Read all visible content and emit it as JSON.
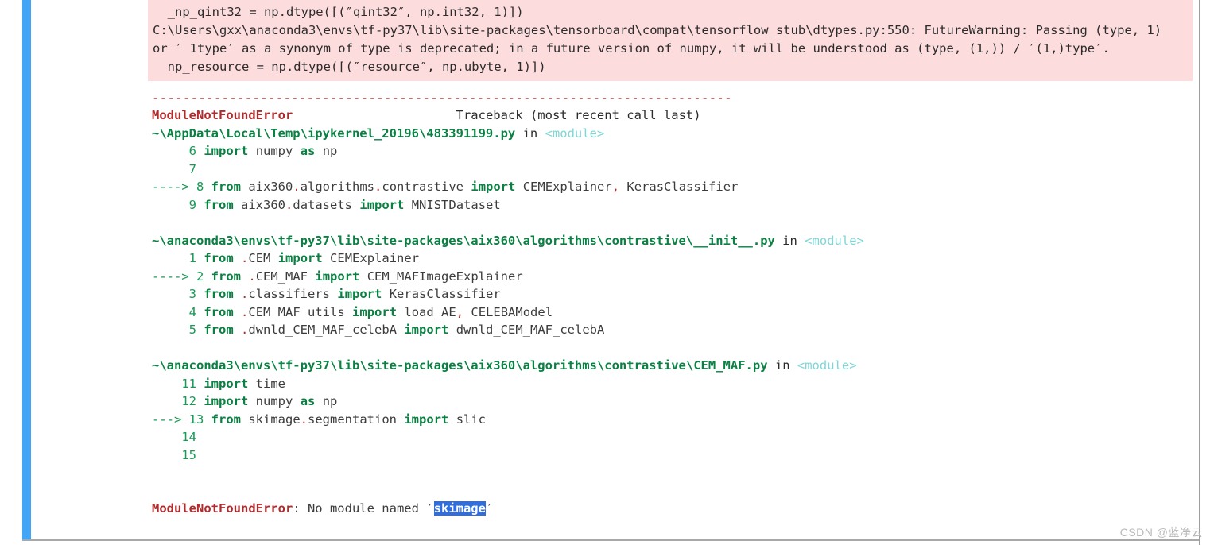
{
  "colors": {
    "cell_selection_bar": "#42a5f5",
    "stderr_background": "#fcdcdc",
    "error_name": "#b02b2b",
    "file_path": "#0a8043",
    "keyword": "#0a8043",
    "line_number": "#159b53",
    "module_tag": "#7fd6d6",
    "separator": "#b03a3a",
    "selection_background": "#2f6ede",
    "selection_text": "#ffffff",
    "watermark": "#b9b9b9"
  },
  "stderr": {
    "lines": [
      "  _np_qint32 = np.dtype([(″qint32″, np.int32, 1)])",
      "C:\\Users\\gxx\\anaconda3\\envs\\tf-py37\\lib\\site-packages\\tensorboard\\compat\\tensorflow_stub\\dtypes.py:550: FutureWarning: Passing (type, 1)",
      "or ′ 1type′ as a synonym of type is deprecated; in a future version of numpy, it will be understood as (type, (1,)) / ′(1,)type′.",
      "  np_resource = np.dtype([(″resource″, np.ubyte, 1)])"
    ]
  },
  "traceback": {
    "separator": "---------------------------------------------------------------------------",
    "header": {
      "exception": "ModuleNotFoundError",
      "gap": "                      ",
      "hint": "Traceback (most recent call last)"
    },
    "frames": [
      {
        "path": "~\\AppData\\Local\\Temp\\ipykernel_20196\\483391199.py",
        "in": " in ",
        "scope": "<module>",
        "lines": [
          {
            "arrow": "     ",
            "no": "6",
            "code_html": "<span class=\"kw\">import</span> <span class=\"plain\">numpy</span> <span class=\"kw\">as</span> <span class=\"plain\">np</span>"
          },
          {
            "arrow": "     ",
            "no": "7",
            "code_html": ""
          },
          {
            "arrow": "----> ",
            "no": "8",
            "code_html": "<span class=\"kw\">from</span> <span class=\"plain\">aix360</span><span class=\"punct\">.</span><span class=\"plain\">algorithms</span><span class=\"punct\">.</span><span class=\"plain\">contrastive</span> <span class=\"kw\">import</span> <span class=\"plain\">CEMExplainer</span><span class=\"punct\">,</span> <span class=\"plain\">KerasClassifier</span>"
          },
          {
            "arrow": "     ",
            "no": "9",
            "code_html": "<span class=\"kw\">from</span> <span class=\"plain\">aix360</span><span class=\"punct\">.</span><span class=\"plain\">datasets</span> <span class=\"kw\">import</span> <span class=\"plain\">MNISTDataset</span>"
          }
        ]
      },
      {
        "path": "~\\anaconda3\\envs\\tf-py37\\lib\\site-packages\\aix360\\algorithms\\contrastive\\__init__.py",
        "in": " in ",
        "scope": "<module>",
        "lines": [
          {
            "arrow": "     ",
            "no": "1",
            "code_html": "<span class=\"kw\">from</span> <span class=\"punct\">.</span><span class=\"plain\">CEM</span> <span class=\"kw\">import</span> <span class=\"plain\">CEMExplainer</span>"
          },
          {
            "arrow": "----> ",
            "no": "2",
            "code_html": "<span class=\"kw\">from</span> <span class=\"punct\">.</span><span class=\"plain\">CEM_MAF</span> <span class=\"kw\">import</span> <span class=\"plain\">CEM_MAFImageExplainer</span>"
          },
          {
            "arrow": "     ",
            "no": "3",
            "code_html": "<span class=\"kw\">from</span> <span class=\"punct\">.</span><span class=\"plain\">classifiers</span> <span class=\"kw\">import</span> <span class=\"plain\">KerasClassifier</span>"
          },
          {
            "arrow": "     ",
            "no": "4",
            "code_html": "<span class=\"kw\">from</span> <span class=\"punct\">.</span><span class=\"plain\">CEM_MAF_utils</span> <span class=\"kw\">import</span> <span class=\"plain\">load_AE</span><span class=\"punct\">,</span> <span class=\"plain\">CELEBAModel</span>"
          },
          {
            "arrow": "     ",
            "no": "5",
            "code_html": "<span class=\"kw\">from</span> <span class=\"punct\">.</span><span class=\"plain\">dwnld_CEM_MAF_celebA</span> <span class=\"kw\">import</span> <span class=\"plain\">dwnld_CEM_MAF_celebA</span>"
          }
        ]
      },
      {
        "path": "~\\anaconda3\\envs\\tf-py37\\lib\\site-packages\\aix360\\algorithms\\contrastive\\CEM_MAF.py",
        "in": " in ",
        "scope": "<module>",
        "lines": [
          {
            "arrow": "    ",
            "no": "11",
            "code_html": "<span class=\"kw\">import</span> <span class=\"plain\">time</span>"
          },
          {
            "arrow": "    ",
            "no": "12",
            "code_html": "<span class=\"kw\">import</span> <span class=\"plain\">numpy</span> <span class=\"kw\">as</span> <span class=\"plain\">np</span>"
          },
          {
            "arrow": "---> ",
            "no": "13",
            "code_html": "<span class=\"kw\">from</span> <span class=\"plain\">skimage</span><span class=\"punct\">.</span><span class=\"plain\">segmentation</span> <span class=\"kw\">import</span> <span class=\"plain\">slic</span>"
          },
          {
            "arrow": "    ",
            "no": "14",
            "code_html": ""
          },
          {
            "arrow": "    ",
            "no": "15",
            "code_html": ""
          }
        ]
      }
    ],
    "final": {
      "exception": "ModuleNotFoundError",
      "message": ": No module named ′",
      "selected_module": "skimage",
      "trailing_quote": "′"
    }
  },
  "watermark": {
    "text": "CSDN @蓝净云"
  }
}
